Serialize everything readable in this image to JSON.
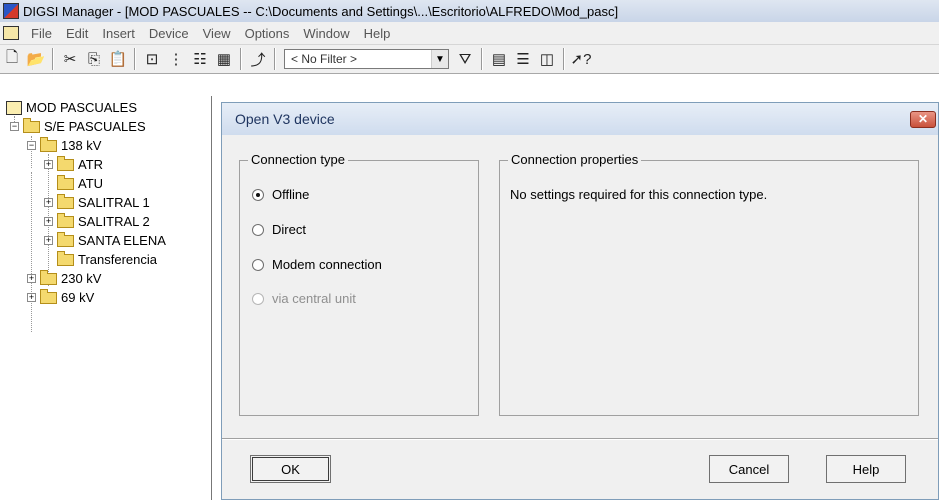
{
  "window": {
    "title": "DIGSI Manager - [MOD PASCUALES -- C:\\Documents and Settings\\...\\Escritorio\\ALFREDO\\Mod_pasc]"
  },
  "menu": [
    "File",
    "Edit",
    "Insert",
    "Device",
    "View",
    "Options",
    "Window",
    "Help"
  ],
  "toolbar": {
    "filter_value": "< No Filter >"
  },
  "tree": {
    "root": "MOD PASCUALES",
    "station": "S/E PASCUALES",
    "nodes": [
      {
        "label": "138 kV"
      },
      {
        "label": "ATR"
      },
      {
        "label": "ATU"
      },
      {
        "label": "SALITRAL 1"
      },
      {
        "label": "SALITRAL 2"
      },
      {
        "label": "SANTA ELENA"
      },
      {
        "label": "Transferencia"
      },
      {
        "label": "230 kV"
      },
      {
        "label": "69 kV"
      }
    ]
  },
  "dialog": {
    "title": "Open V3 device",
    "connection_type_label": "Connection type",
    "options": [
      {
        "label": "Offline",
        "checked": true,
        "enabled": true
      },
      {
        "label": "Direct",
        "checked": false,
        "enabled": true
      },
      {
        "label": "Modem connection",
        "checked": false,
        "enabled": true
      },
      {
        "label": "via central unit",
        "checked": false,
        "enabled": false
      }
    ],
    "connection_properties_label": "Connection properties",
    "properties_text": "No settings required for this connection type.",
    "ok_label": "OK",
    "cancel_label": "Cancel",
    "help_label": "Help"
  }
}
